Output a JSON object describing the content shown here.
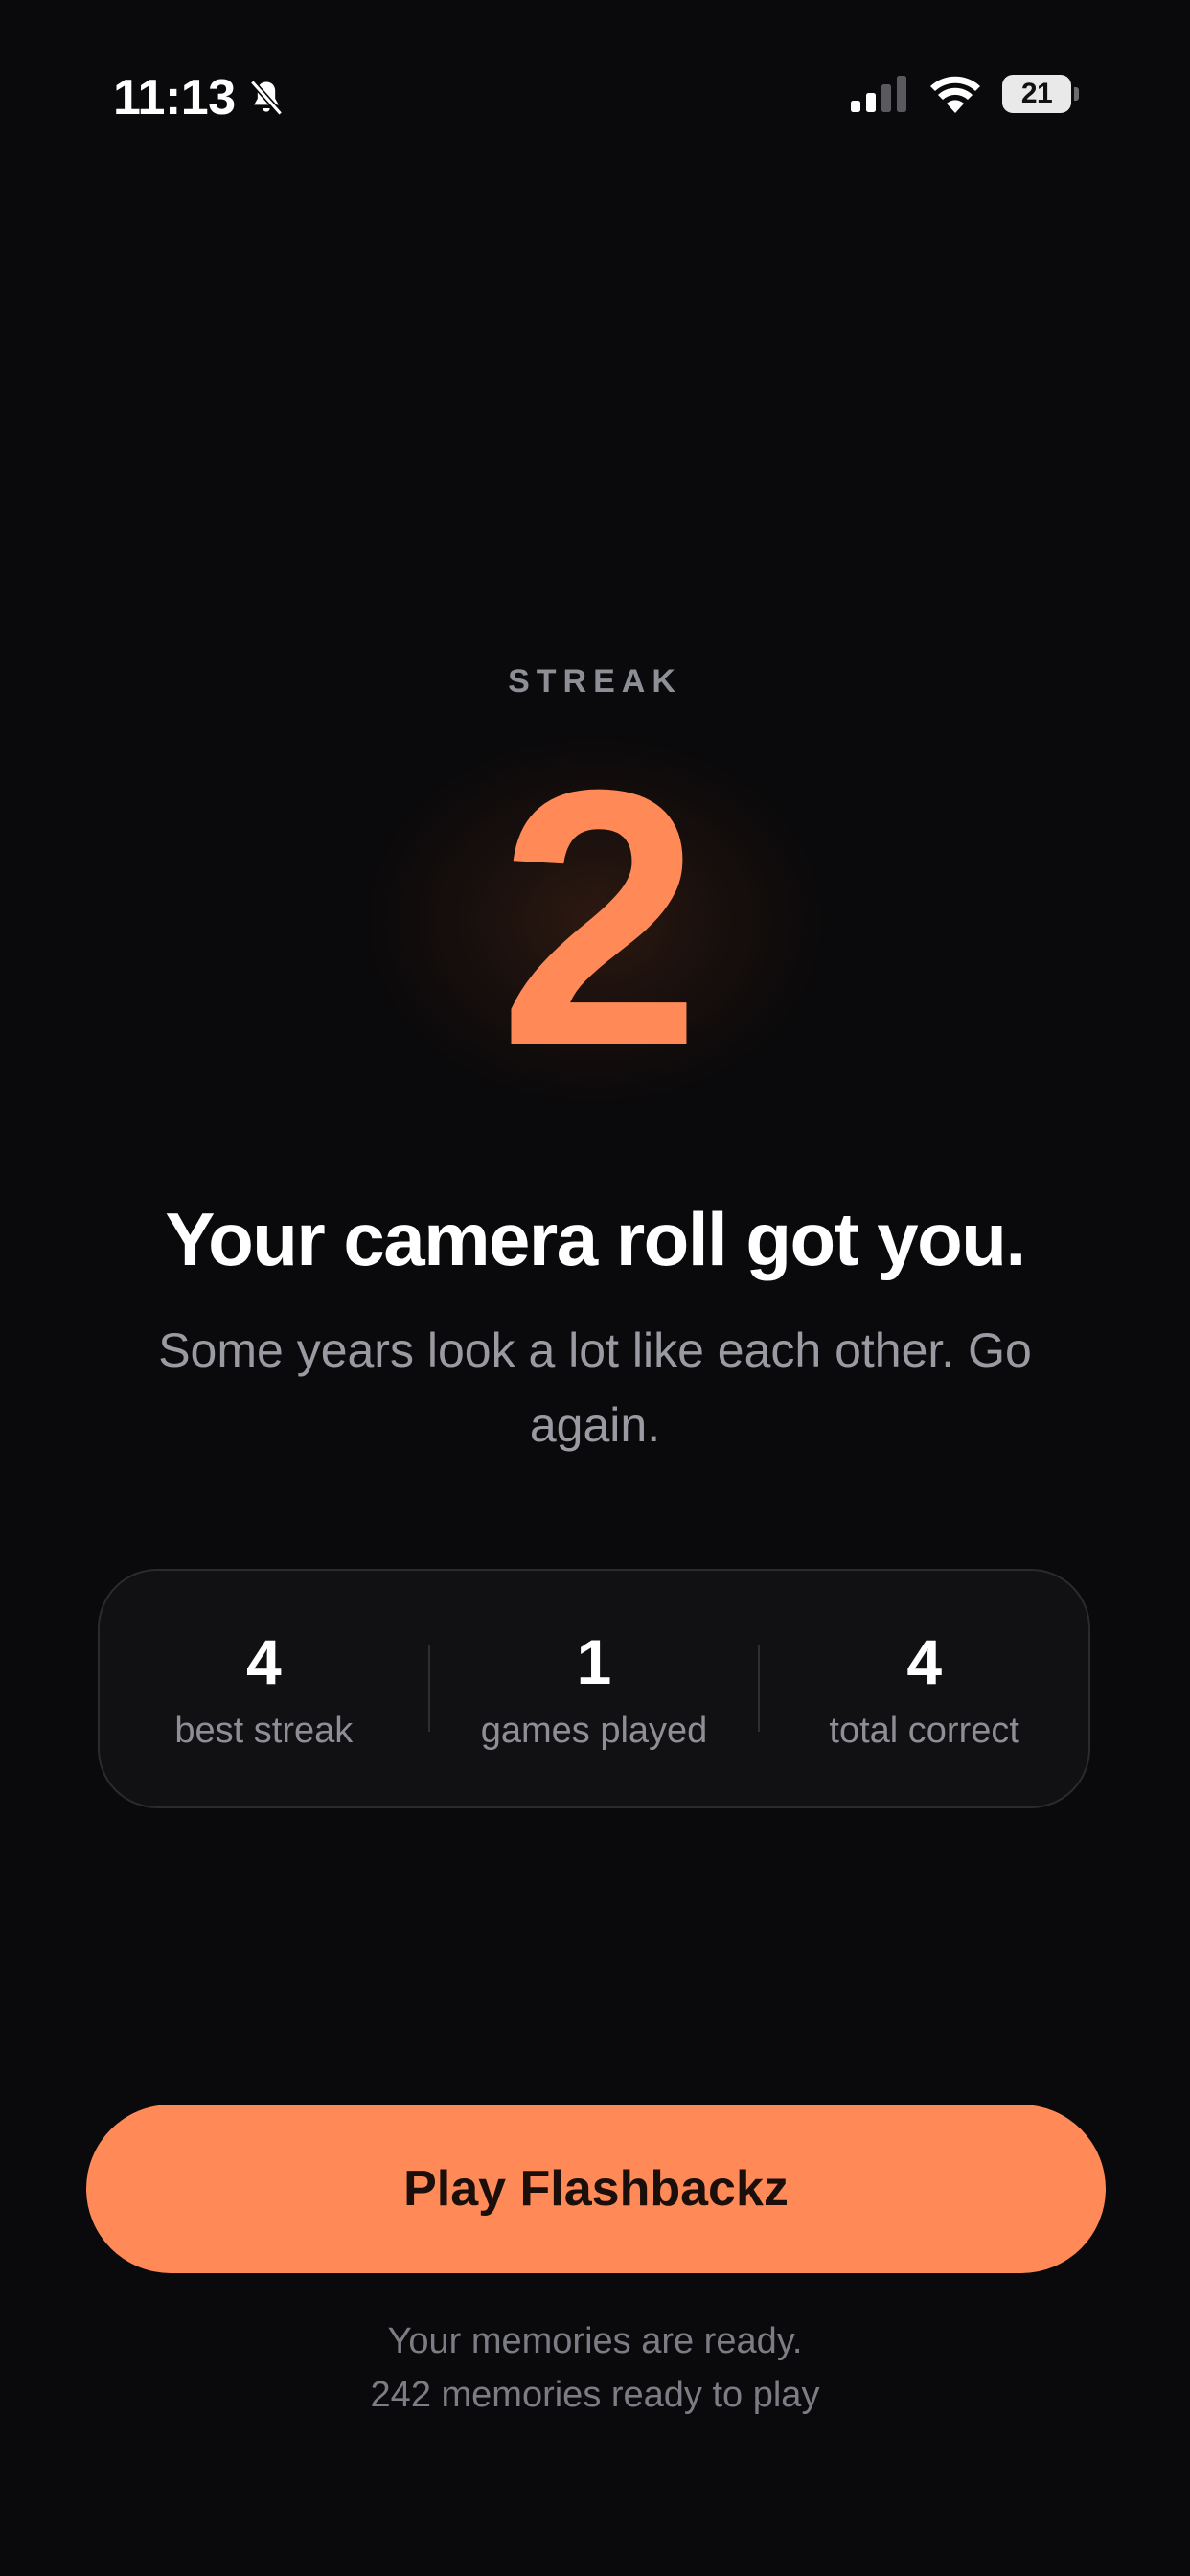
{
  "status_bar": {
    "time": "11:13",
    "battery": "21",
    "icons": [
      "bell-slash-icon",
      "signal-icon",
      "wifi-icon",
      "battery-icon"
    ]
  },
  "streak": {
    "label": "STREAK",
    "value": "2"
  },
  "headline": "Your camera roll got you.",
  "subtext": "Some years look a lot like each other. Go again.",
  "stats": [
    {
      "value": "4",
      "label": "best streak"
    },
    {
      "value": "1",
      "label": "games played"
    },
    {
      "value": "4",
      "label": "total correct"
    }
  ],
  "play_button_label": "Play Flashbackz",
  "footer": {
    "line1": "Your memories are ready.",
    "line2": "242 memories ready to play"
  },
  "colors": {
    "background": "#0a090b",
    "accent": "#ff8a57",
    "muted_text": "#9a9aa2"
  }
}
